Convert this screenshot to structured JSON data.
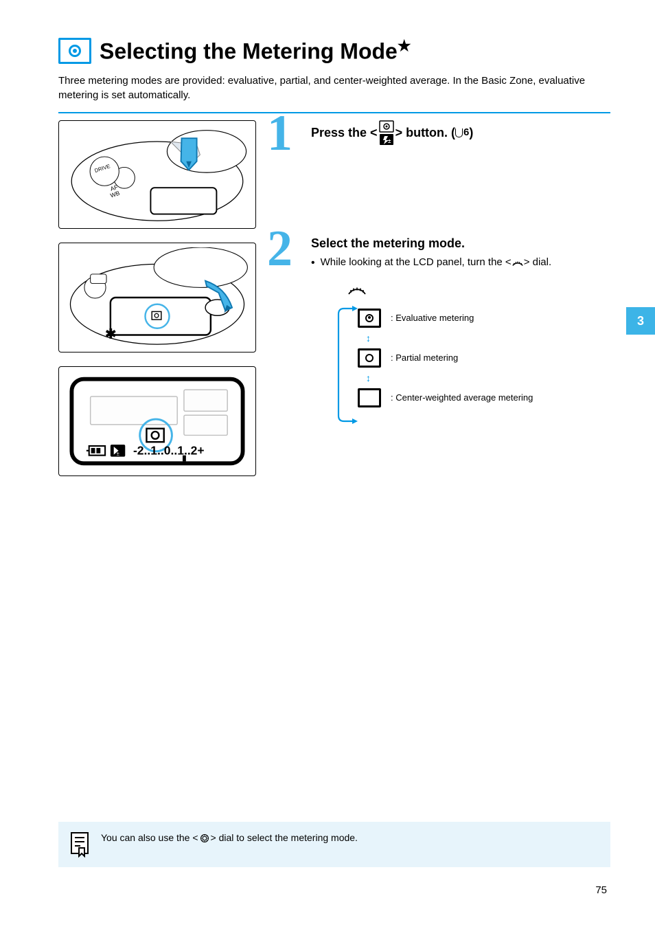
{
  "chapter_tab": "3",
  "page_number_top": "",
  "page_number": "75",
  "title_line1": "Selecting the Metering Mode",
  "title_star": "★",
  "intro": "Three metering modes are provided: evaluative, partial, and center-weighted average. In the Basic Zone, evaluative metering is set automatically.",
  "step1": {
    "heading_pre": "Press the <",
    "heading_post": "> button. (",
    "heading_end": ")"
  },
  "step2": {
    "heading": "Select the metering mode.",
    "bullet1_pre": "While looking at the LCD panel, turn the <",
    "bullet1_post": "> dial.",
    "modes": [
      {
        "label": ": Evaluative metering"
      },
      {
        "label": ": Partial metering"
      },
      {
        "label": ": Center-weighted average metering"
      }
    ]
  },
  "note_pre": "You can also use the <",
  "note_post": "> dial to select the metering mode."
}
